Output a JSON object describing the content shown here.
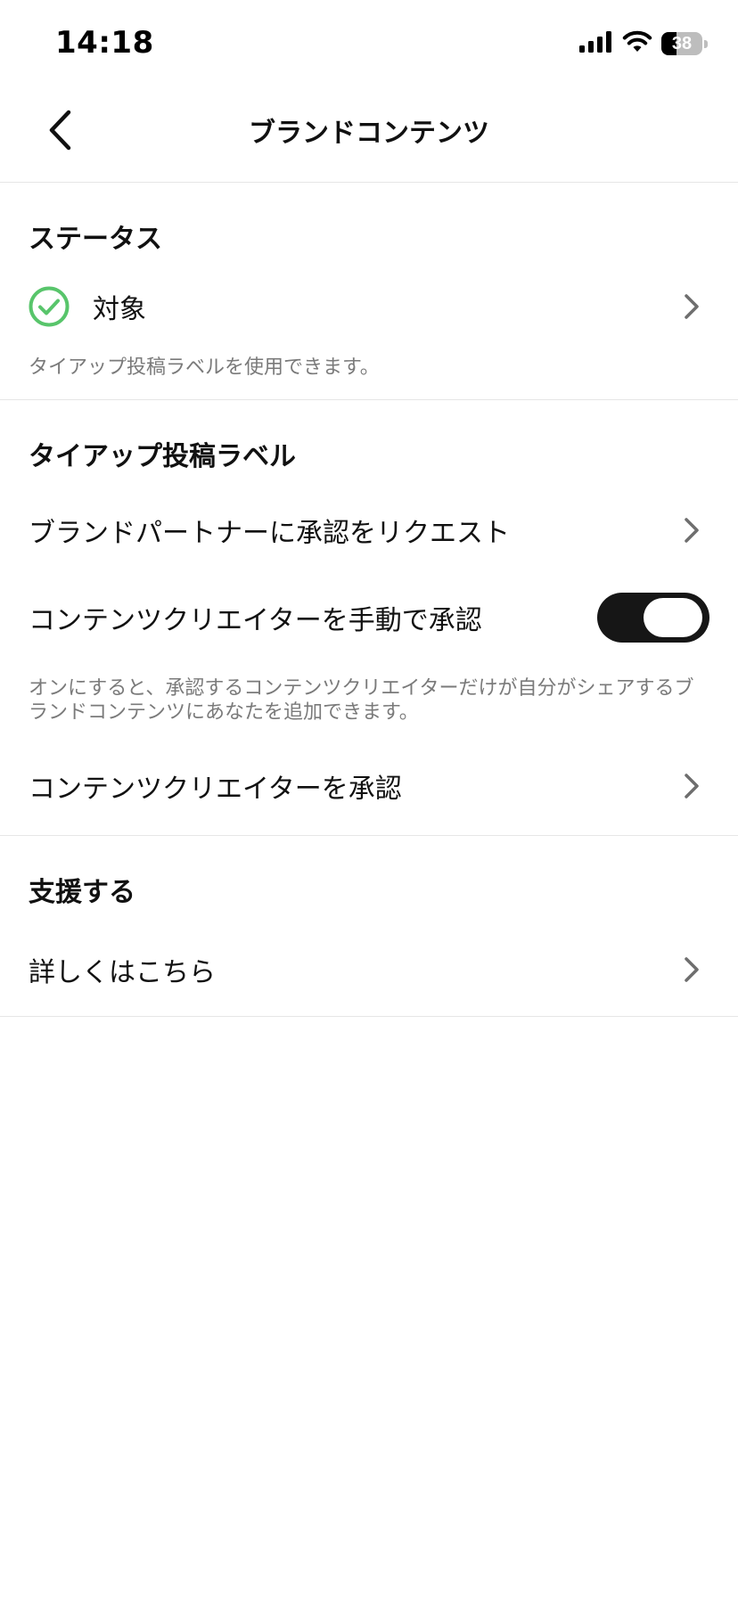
{
  "status_bar": {
    "time": "14:18",
    "battery_level": "38",
    "battery_fraction": 0.38,
    "icons": [
      "signal-icon",
      "wifi-icon",
      "battery-icon"
    ]
  },
  "nav": {
    "title": "ブランドコンテンツ",
    "back_icon": "chevron-left-icon"
  },
  "sections": {
    "status": {
      "title": "ステータス",
      "row_label": "対象",
      "row_icon": "check-circle-icon",
      "helper": "タイアップ投稿ラベルを使用できます。"
    },
    "label": {
      "title": "タイアップ投稿ラベル",
      "request_row": "ブランドパートナーに承認をリクエスト",
      "manual_row": "コンテンツクリエイターを手動で承認",
      "manual_toggle_on": true,
      "helper": "オンにすると、承認するコンテンツクリエイターだけが自分がシェアするブランドコンテンツにあなたを追加できます。",
      "approve_row": "コンテンツクリエイターを承認"
    },
    "support": {
      "title": "支援する",
      "learn_more_row": "詳しくはこちら"
    }
  },
  "colors": {
    "check_green": "#58c56b",
    "chevron_gray": "#6e6e6e",
    "helper_gray": "#7a7a7a",
    "toggle_on": "#161616",
    "divider": "#e6e6e6"
  }
}
